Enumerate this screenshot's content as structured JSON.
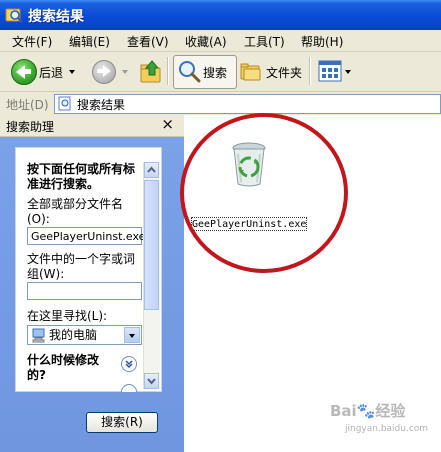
{
  "window": {
    "title": "搜索结果"
  },
  "menu": [
    "文件(F)",
    "编辑(E)",
    "查看(V)",
    "收藏(A)",
    "工具(T)",
    "帮助(H)"
  ],
  "toolbar": {
    "back_label": "后退",
    "search_label": "搜索",
    "folders_label": "文件夹"
  },
  "address": {
    "label": "地址(D)",
    "value": "搜索结果"
  },
  "search_pane": {
    "title": "搜索助理",
    "close": "×",
    "heading": "按下面任何或所有标准进行搜索。",
    "filename_label": "全部或部分文件名(O):",
    "filename_value": "GeePlayerUninst.exe",
    "phrase_label": "文件中的一个字或词组(W):",
    "phrase_value": "",
    "look_in_label": "在这里寻找(L):",
    "look_in_value": "我的电脑",
    "when_modified_label": "什么时候修改的?",
    "search_button": "搜索(R)"
  },
  "results": {
    "items": [
      {
        "name": "GeePlayerUninst.exe",
        "icon": "recycle-bin-icon"
      }
    ]
  },
  "watermark": {
    "text": "Bai🐾经验",
    "sub": "jingyan.baidu.com"
  },
  "colors": {
    "titlebar": "#0a4bd6",
    "pane": "#6f96df",
    "highlight_circle": "#c0161c"
  }
}
